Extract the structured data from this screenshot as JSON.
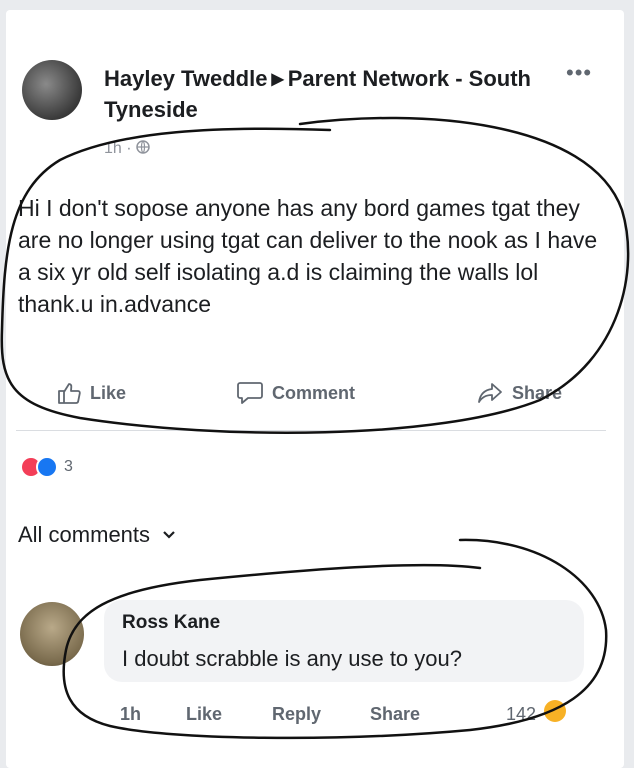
{
  "post": {
    "author": "Hayley Tweddle",
    "group": "Parent Network - South Tyneside",
    "time": "1h",
    "more": "•••",
    "text": "Hi I don't sopose anyone has any bord games tgat they are no longer using tgat can deliver to the nook as I have a six yr old self isolating a.d is claiming the walls lol  thank.u in.advance"
  },
  "actions": {
    "like": "Like",
    "comment": "Comment",
    "share": "Share"
  },
  "reactions": {
    "count": "3"
  },
  "comments": {
    "filter_label": "All comments",
    "items": [
      {
        "author": "Ross Kane",
        "text": "I doubt scrabble is any use to you?",
        "time": "1h",
        "like": "Like",
        "reply": "Reply",
        "share": "Share",
        "reactions": "142"
      }
    ]
  }
}
